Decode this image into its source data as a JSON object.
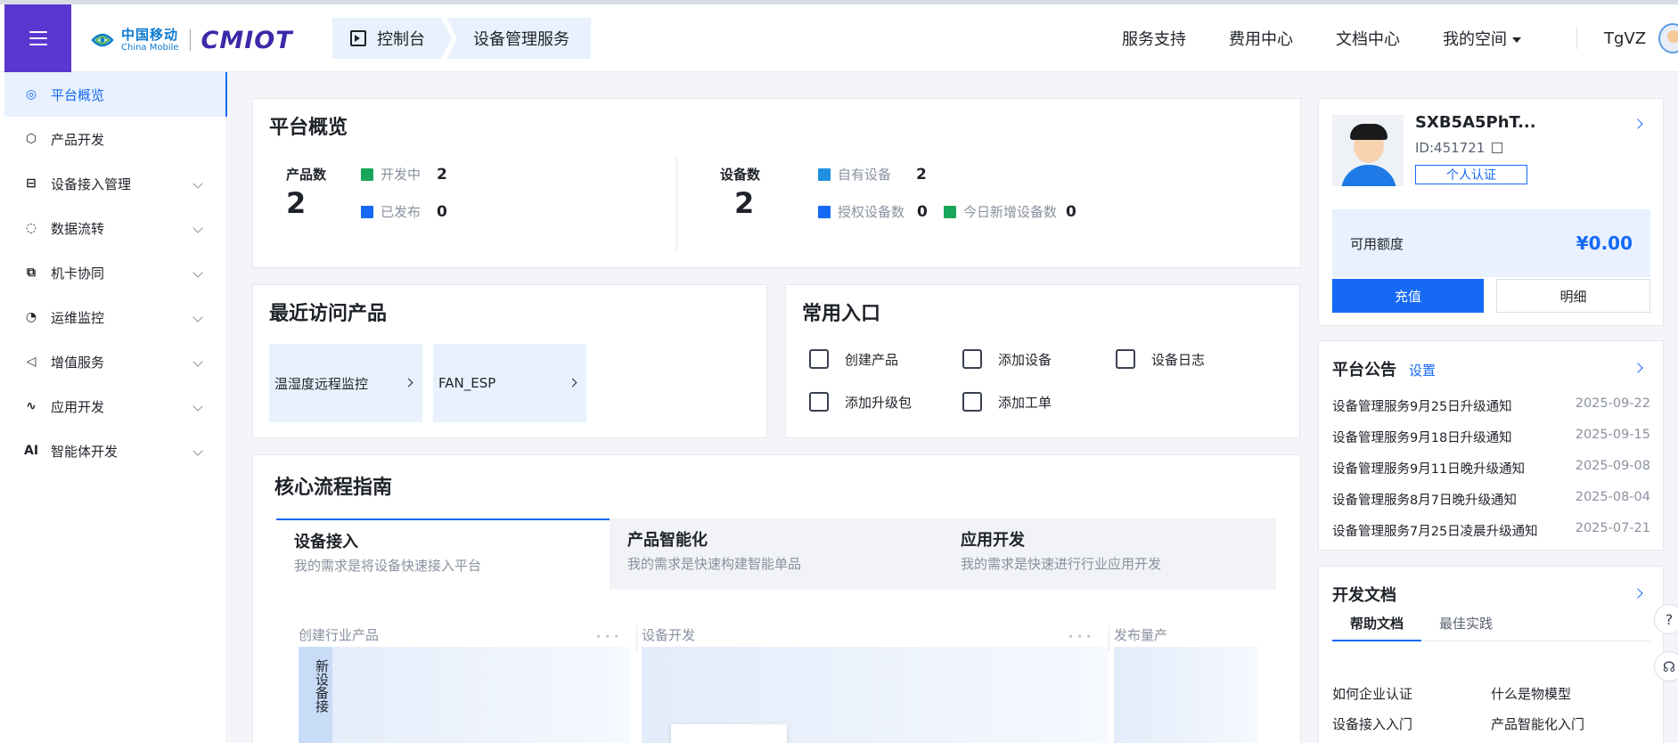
{
  "header": {
    "brand_zh": "中国移动",
    "brand_en": "China Mobile",
    "product": "CMIOT",
    "breadcrumb": [
      "控制台",
      "设备管理服务"
    ],
    "nav": [
      "服务支持",
      "费用中心",
      "文档中心",
      "我的空间"
    ],
    "username": "TgVZ"
  },
  "sidebar": {
    "items": [
      {
        "label": "平台概览",
        "icon": "◎"
      },
      {
        "label": "产品开发",
        "icon": "⬡"
      },
      {
        "label": "设备接入管理",
        "icon": "⊟"
      },
      {
        "label": "数据流转",
        "icon": "◌"
      },
      {
        "label": "机卡协同",
        "icon": "⧉"
      },
      {
        "label": "运维监控",
        "icon": "◔"
      },
      {
        "label": "增值服务",
        "icon": "◁"
      },
      {
        "label": "应用开发",
        "icon": "∿"
      },
      {
        "label": "智能体开发",
        "icon": "AI"
      }
    ]
  },
  "overview": {
    "title": "平台概览",
    "product_label": "产品数",
    "product_count": "2",
    "dev_label": "开发中",
    "dev_count": "2",
    "pub_label": "已发布",
    "pub_count": "0",
    "device_label": "设备数",
    "device_count": "2",
    "own_label": "自有设备",
    "own_count": "2",
    "auth_label": "授权设备数",
    "auth_count": "0",
    "today_label": "今日新增设备数",
    "today_count": "0"
  },
  "recent": {
    "title": "最近访问产品",
    "items": [
      "温湿度远程监控",
      "FAN_ESP"
    ]
  },
  "common": {
    "title": "常用入口",
    "items": [
      "创建产品",
      "添加设备",
      "设备日志",
      "添加升级包",
      "添加工单"
    ]
  },
  "guide": {
    "title": "核心流程指南",
    "tabs": [
      {
        "title": "设备接入",
        "desc": "我的需求是将设备快速接入平台"
      },
      {
        "title": "产品智能化",
        "desc": "我的需求是快速构建智能单品"
      },
      {
        "title": "应用开发",
        "desc": "我的需求是快速进行行业应用开发"
      }
    ],
    "steps": [
      "创建行业产品",
      "设备开发",
      "发布量产"
    ],
    "new_device": "新设备接"
  },
  "account": {
    "name": "SXB5A5PhT...",
    "id": "ID:451721",
    "auth": "个人认证",
    "quota_label": "可用额度",
    "quota_value": "¥0.00",
    "charge": "充值",
    "detail": "明细"
  },
  "notice": {
    "title": "平台公告",
    "setting": "设置",
    "items": [
      {
        "text": "设备管理服务9月25日升级通知",
        "date": "2025-09-22"
      },
      {
        "text": "设备管理服务9月18日升级通知",
        "date": "2025-09-15"
      },
      {
        "text": "设备管理服务9月11日晚升级通知",
        "date": "2025-09-08"
      },
      {
        "text": "设备管理服务8月7日晚升级通知",
        "date": "2025-08-04"
      },
      {
        "text": "设备管理服务7月25日凌晨升级通知",
        "date": "2025-07-21"
      }
    ]
  },
  "docs": {
    "title": "开发文档",
    "tabs": [
      "帮助文档",
      "最佳实践"
    ],
    "links": [
      "如何企业认证",
      "什么是物模型",
      "设备接入入门",
      "产品智能化入门"
    ]
  },
  "colors": {
    "accent": "#1669f5",
    "brand": "#5b36d1"
  }
}
